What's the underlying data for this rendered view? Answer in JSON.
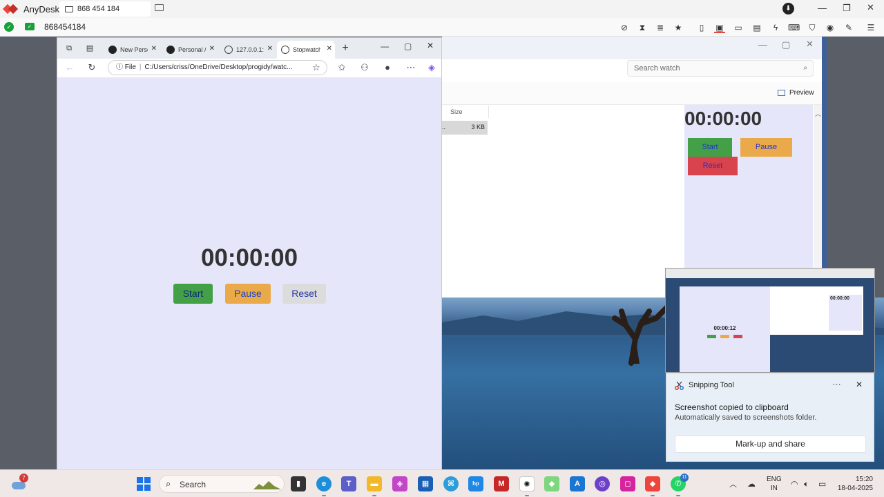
{
  "anydesk": {
    "app_name": "AnyDesk",
    "session_tab": "868 454 184",
    "address": "868454184",
    "down_icon": "download-arrow-icon"
  },
  "explorer": {
    "search_placeholder": "Search watch",
    "preview_label": "Preview",
    "column_size": "Size",
    "row_name": "..",
    "row_size": "3 KB",
    "preview_pane": {
      "timer": "00:00:00",
      "start": "Start",
      "pause": "Pause",
      "reset": "Reset"
    }
  },
  "edge": {
    "tabs": [
      {
        "label": "New Perso",
        "icon": "github-icon"
      },
      {
        "label": "Personal /",
        "icon": "github-icon"
      },
      {
        "label": "127.0.0.1:",
        "icon": "globe-icon"
      },
      {
        "label": "Stopwatch",
        "icon": "globe-icon",
        "active": true
      }
    ],
    "url_prefix": "File",
    "url": "C:/Users/criss/OneDrive/Desktop/progidy/watc..."
  },
  "stopwatch": {
    "timer": "00:00:00",
    "start": "Start",
    "pause": "Pause",
    "reset": "Reset"
  },
  "thumbnail": {
    "timer": "00:00:12",
    "preview_timer": "00:00:00"
  },
  "snipping": {
    "app": "Snipping Tool",
    "title": "Screenshot copied to clipboard",
    "body": "Automatically saved to screenshots folder.",
    "action": "Mark-up and share"
  },
  "taskbar": {
    "weather_badge": "7",
    "search": "Search",
    "whatsapp_badge": "11",
    "lang_line1": "ENG",
    "lang_line2": "IN",
    "time": "15:20",
    "date": "18-04-2025"
  },
  "colors": {
    "stopwatch_bg": "#e6e6fa",
    "start_green": "#43a047",
    "pause_orange": "#ebaa4a",
    "reset_red": "#d9434e",
    "anydesk_red": "#ef443b"
  }
}
